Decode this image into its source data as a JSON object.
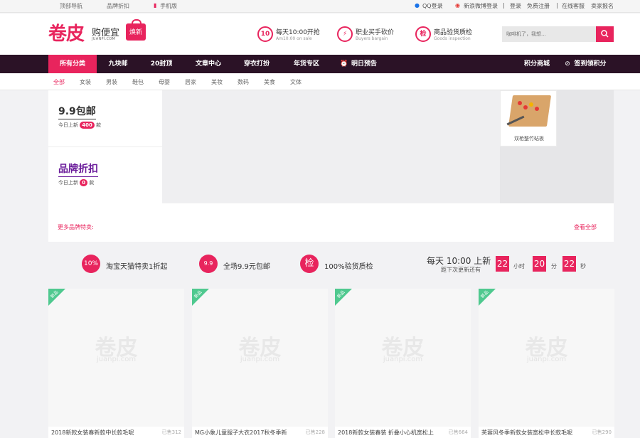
{
  "topbar": {
    "left_links": [
      "顶部导航",
      "品牌折扣",
      "手机版"
    ],
    "qq_login": "QQ登录",
    "weibo_login": "新浪微博登录",
    "login": "登录",
    "register": "免费注册",
    "service": "在线客服",
    "seller_signup": "卖家报名"
  },
  "header": {
    "logo_main": "卷皮",
    "logo_sub": "购便宜",
    "logo_url": "JUANPI.COM",
    "logo_badge": "焕新",
    "features": [
      {
        "icon": "clock-icon",
        "glyph": "10",
        "title": "每天10:00开抢",
        "sub": "Am10:00 on sale"
      },
      {
        "icon": "lightning-icon",
        "glyph": "⚡",
        "title": "职业买手砍价",
        "sub": "Buyers bargain"
      },
      {
        "icon": "check-seal-icon",
        "glyph": "检",
        "title": "商品验货质检",
        "sub": "Goods inspection"
      }
    ],
    "search_placeholder": "咖啡机了，我想..."
  },
  "nav": {
    "items": [
      "所有分类",
      "九块邮",
      "20封顶",
      "文章中心",
      "穿衣打扮",
      "年货专区",
      "明日预告"
    ],
    "points_mall": "积分商城",
    "checkin": "签到领积分"
  },
  "subnav": {
    "items": [
      "全部",
      "女装",
      "男装",
      "鞋包",
      "母婴",
      "居家",
      "美妆",
      "数码",
      "美食",
      "文体"
    ]
  },
  "brand": {
    "block1_title": "9.9包邮",
    "block1_prefix": "今日上新",
    "block1_count": "400",
    "block1_suffix": "款",
    "block2_title": "品牌折扣",
    "block2_prefix": "今日上新",
    "block2_count": "0",
    "block2_suffix": "款",
    "item_caption": "双枪整竹砧板",
    "more_link": "更多品牌特卖:",
    "view_all": "查看全部"
  },
  "promise": {
    "items": [
      {
        "glyph": "10%",
        "text": "淘宝天猫特卖1折起"
      },
      {
        "glyph": "9.9",
        "text": "全场9.9元包邮"
      },
      {
        "glyph": "检",
        "text": "100%验货质检"
      }
    ],
    "countdown_title": "每天 10:00 上新",
    "countdown_sub": "距下次更新还有",
    "hours": "22",
    "hours_unit": "小时",
    "minutes": "20",
    "minutes_unit": "分",
    "seconds": "22",
    "seconds_unit": "秒"
  },
  "products": [
    {
      "badge": "新品",
      "watermark": "卷皮",
      "watermark_url": "juanpi.com",
      "title": "2018新款女装春新款中长款毛呢",
      "sold": "已售312"
    },
    {
      "badge": "新品",
      "watermark": "卷皮",
      "watermark_url": "juanpi.com",
      "title": "MG小象儿童服子大衣2017秋冬季新",
      "sold": "已售228"
    },
    {
      "badge": "新品",
      "watermark": "卷皮",
      "watermark_url": "juanpi.com",
      "title": "2018新款女装春装 折叠小心机宽松上",
      "sold": "已售664"
    },
    {
      "badge": "新品",
      "watermark": "卷皮",
      "watermark_url": "juanpi.com",
      "title": "芙蓉风冬季新款女装宽松中长款毛呢",
      "sold": "已售290"
    }
  ]
}
